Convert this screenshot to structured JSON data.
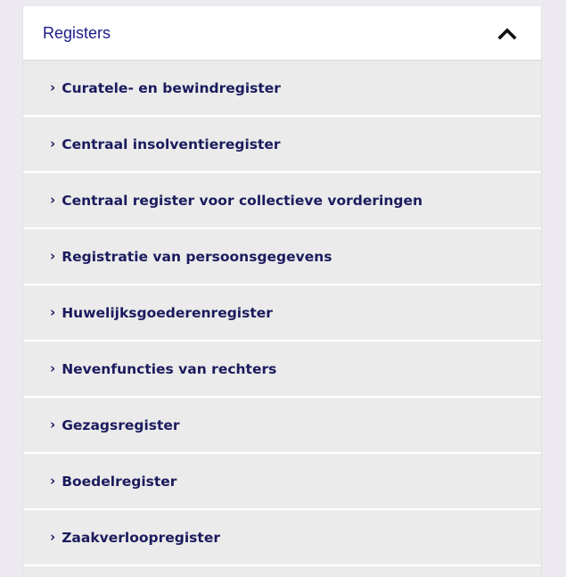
{
  "panel": {
    "title": "Registers",
    "collapse_icon": "chevron-up-icon",
    "items": [
      {
        "label": "Curatele- en bewindregister"
      },
      {
        "label": "Centraal insolventieregister"
      },
      {
        "label": "Centraal register voor collectieve vorderingen"
      },
      {
        "label": "Registratie van persoonsgegevens"
      },
      {
        "label": "Huwelijksgoederenregister"
      },
      {
        "label": "Nevenfuncties van rechters"
      },
      {
        "label": "Gezagsregister"
      },
      {
        "label": "Boedelregister"
      },
      {
        "label": "Zaakverloopregister"
      }
    ],
    "item_marker": "›"
  },
  "colors": {
    "page_background": "#ece9f0",
    "header_background": "#ffffff",
    "item_background": "#ebebeb",
    "title_color": "#1b1b8a",
    "item_text_color": "#1b1b5e"
  }
}
